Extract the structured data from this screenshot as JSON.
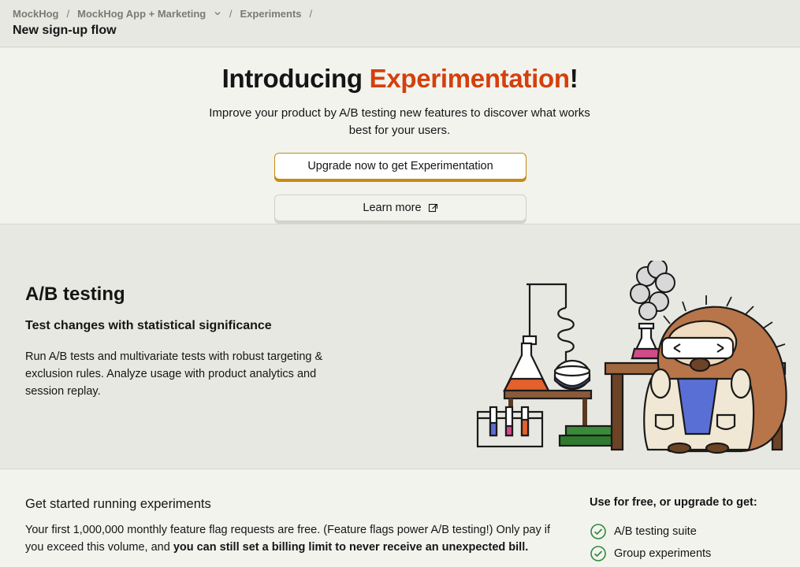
{
  "breadcrumbs": {
    "org": "MockHog",
    "project": "MockHog App + Marketing",
    "section": "Experiments",
    "separator": "/"
  },
  "page_title": "New sign-up flow",
  "hero": {
    "title_prefix": "Introducing ",
    "title_accent": "Experimentation",
    "title_suffix": "!",
    "accent_color": "#d4400c",
    "description": "Improve your product by A/B testing new features to discover what works best for your users.",
    "upgrade_button": "Upgrade now to get Experimentation",
    "learn_more_button": "Learn more"
  },
  "feature": {
    "title": "A/B testing",
    "subtitle": "Test changes with statistical significance",
    "description": "Run A/B tests and multivariate tests with robust targeting & exclusion rules. Analyze usage with product analytics and session replay."
  },
  "pricing": {
    "heading": "Get started running experiments",
    "free_text_plain": "Your first 1,000,000 monthly feature flag requests are free. (Feature flags power A/B testing!) Only pay if you exceed this volume, and ",
    "free_text_bold": "you can still set a billing limit to never receive an unexpected bill.",
    "upgrade_heading": "Use for free, or upgrade to get:",
    "benefits": [
      "A/B testing suite",
      "Group experiments"
    ],
    "check_color": "#2f8a3b"
  }
}
